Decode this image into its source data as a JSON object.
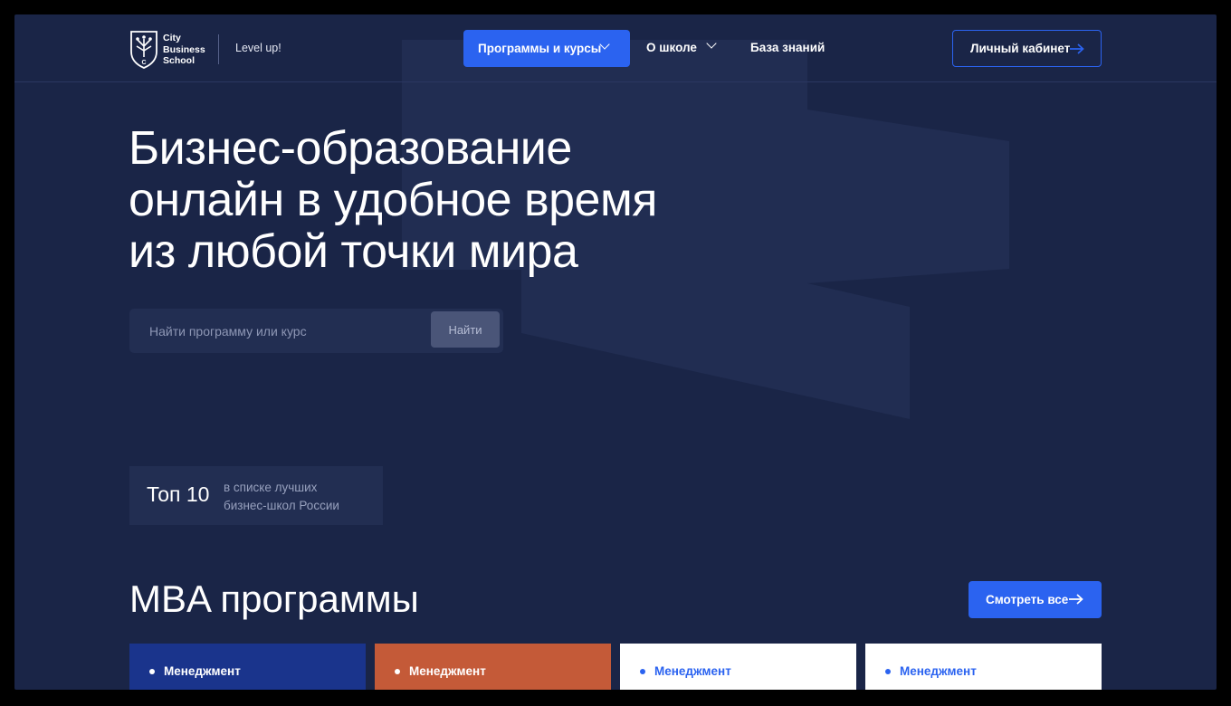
{
  "brand": {
    "name_lines": [
      "City",
      "Business",
      "School"
    ],
    "tagline": "Level up!"
  },
  "nav": {
    "programs_label": "Программы и курсы",
    "about_label": "О школе",
    "knowledge_label": "База знаний",
    "cabinet_label": "Личный кабинет"
  },
  "hero": {
    "title_lines": [
      "Бизнес-образование",
      "онлайн в удобное время",
      "из любой точки мира"
    ]
  },
  "search": {
    "placeholder": "Найти программу или курс",
    "button_label": "Найти"
  },
  "rating": {
    "value": "Топ 10",
    "text_lines": [
      "в списке лучших",
      "бизнес-школ России"
    ]
  },
  "mba": {
    "title": "MBA программы",
    "see_all_label": "Смотреть все",
    "cards": [
      {
        "label": "Менеджмент",
        "bg": "#1a348c",
        "fg": "#ffffff"
      },
      {
        "label": "Менеджмент",
        "bg": "#c45a38",
        "fg": "#ffffff"
      },
      {
        "label": "Менеджмент",
        "bg": "#ffffff",
        "fg": "#2b63f0"
      },
      {
        "label": "Менеджмент",
        "bg": "#ffffff",
        "fg": "#2b63f0"
      }
    ]
  },
  "colors": {
    "page_bg": "#1a2547",
    "accent": "#2b63f0",
    "panel": "#222e52"
  },
  "icons": [
    "tree-shield-logo-icon",
    "chevron-down-icon",
    "arrow-right-icon"
  ]
}
